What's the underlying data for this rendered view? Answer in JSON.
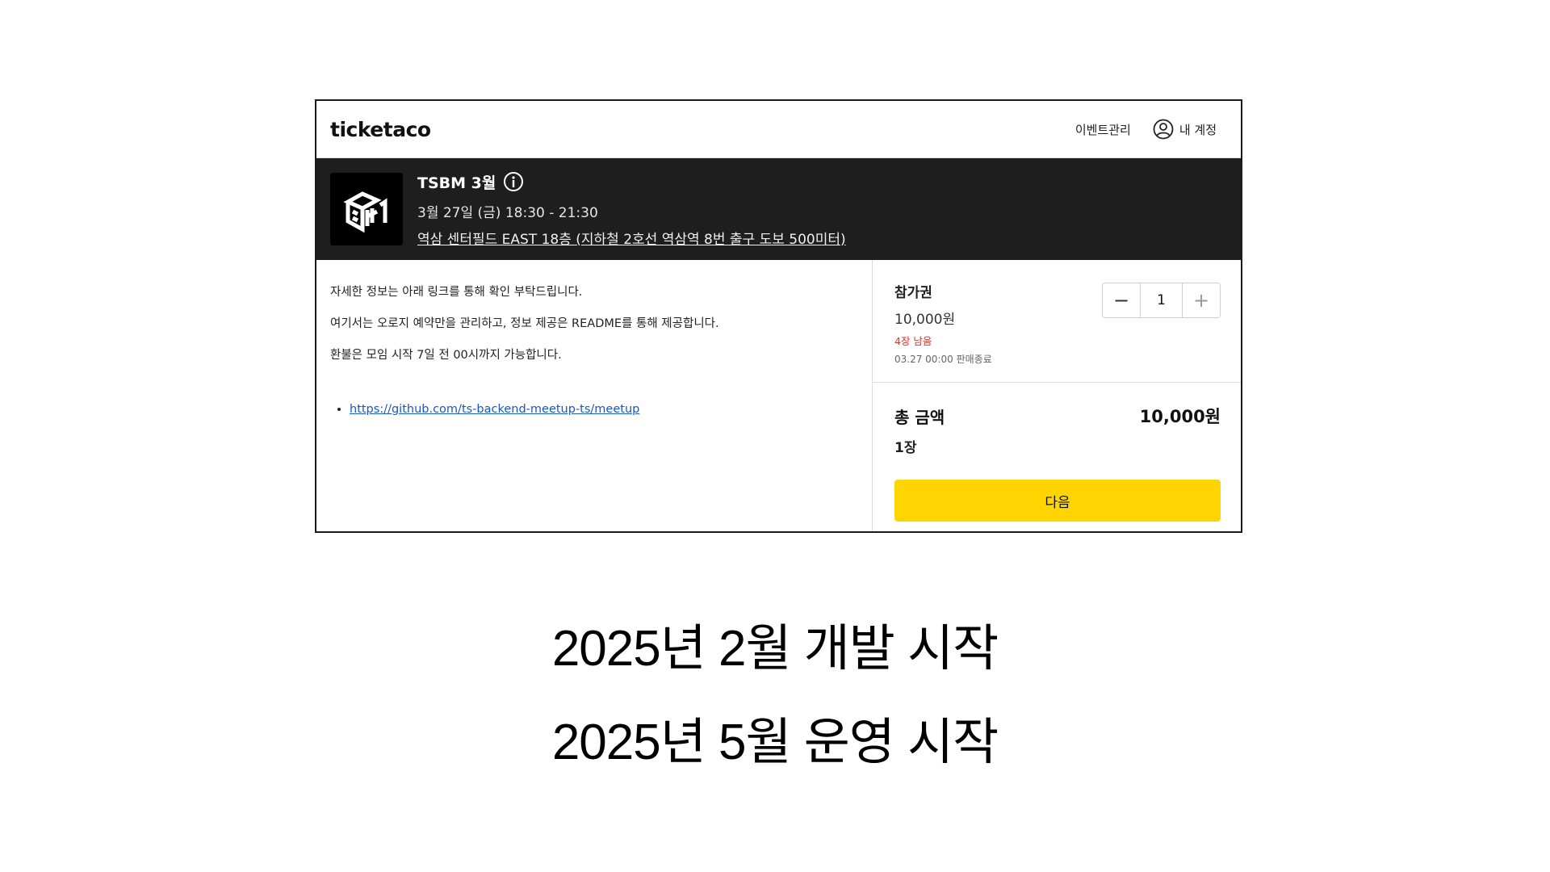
{
  "header": {
    "brand": "ticketaco",
    "event_manage": "이벤트관리",
    "account": "내 계정"
  },
  "event": {
    "title": "TSBM 3월",
    "date": "3월 27일 (금) 18:30 - 21:30",
    "venue": "역삼 센터필드 EAST 18층 (지하철 2호선 역삼역 8번 출구 도보 500미터)"
  },
  "description": {
    "lines": [
      "자세한 정보는 아래 링크를 통해 확인 부탁드립니다.",
      "여기서는 오로지 예약만을 관리하고, 정보 제공은 README를 통해 제공합니다.",
      "환불은 모임 시작 7일 전 00시까지 가능합니다."
    ],
    "link": "https://github.com/ts-backend-meetup-ts/meetup"
  },
  "ticket": {
    "name": "참가권",
    "price": "10,000원",
    "remaining": "4장 남음",
    "deadline": "03.27 00:00 판매종료",
    "quantity": "1",
    "minus": "−",
    "plus": "+"
  },
  "total": {
    "label": "총 금액",
    "amount": "10,000원",
    "count": "1장",
    "next_button": "다음"
  },
  "captions": [
    "2025년 2월 개발 시작",
    "2025년 5월 운영 시작"
  ],
  "colors": {
    "accent": "#ffd400",
    "banner": "#1e1e1e",
    "warning": "#e5332a",
    "link": "#1a56c4"
  }
}
